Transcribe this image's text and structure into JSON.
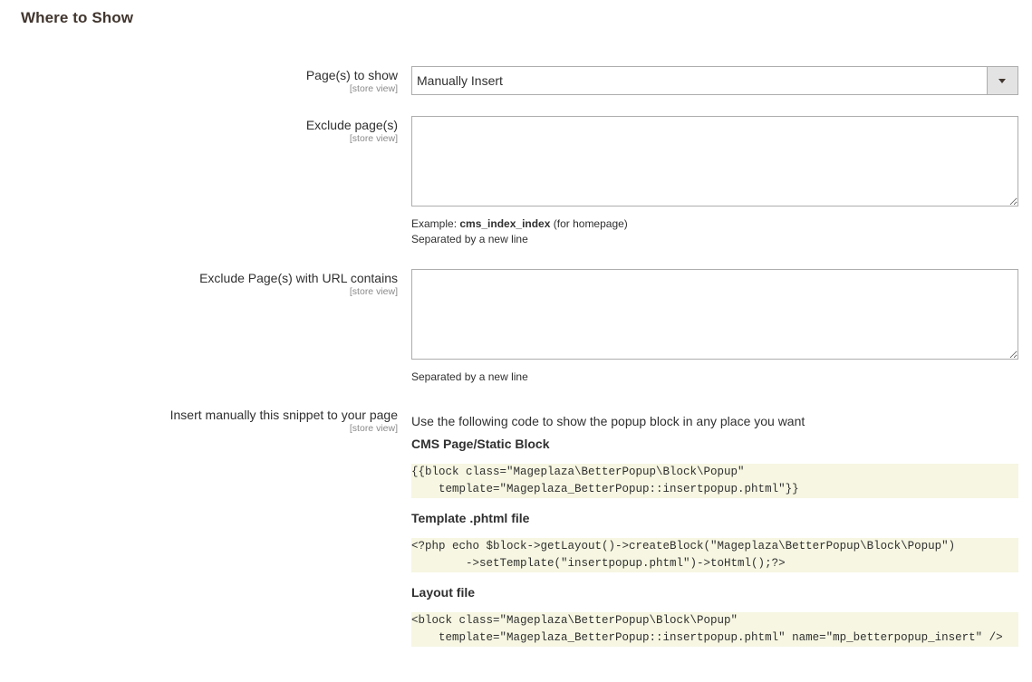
{
  "section": {
    "title": "Where to Show"
  },
  "scope_label": "[store view]",
  "fields": {
    "pages_to_show": {
      "label": "Page(s) to show",
      "value": "Manually Insert"
    },
    "exclude_pages": {
      "label": "Exclude page(s)",
      "value": "",
      "note_prefix": "Example: ",
      "note_bold": "cms_index_index",
      "note_suffix": " (for homepage)",
      "note_line2": "Separated by a new line"
    },
    "exclude_url": {
      "label": "Exclude Page(s) with URL contains",
      "value": "",
      "note": "Separated by a new line"
    },
    "snippet": {
      "label": "Insert manually this snippet to your page",
      "intro": "Use the following code to show the popup block in any place you want",
      "blocks": [
        {
          "title": "CMS Page/Static Block",
          "code": "{{block class=\"Mageplaza\\BetterPopup\\Block\\Popup\"\n    template=\"Mageplaza_BetterPopup::insertpopup.phtml\"}}"
        },
        {
          "title": "Template .phtml file",
          "code": "<?php echo $block->getLayout()->createBlock(\"Mageplaza\\BetterPopup\\Block\\Popup\")\n        ->setTemplate(\"insertpopup.phtml\")->toHtml();?>"
        },
        {
          "title": "Layout file",
          "code": "<block class=\"Mageplaza\\BetterPopup\\Block\\Popup\"\n    template=\"Mageplaza_BetterPopup::insertpopup.phtml\" name=\"mp_betterpopup_insert\" />"
        }
      ]
    }
  }
}
